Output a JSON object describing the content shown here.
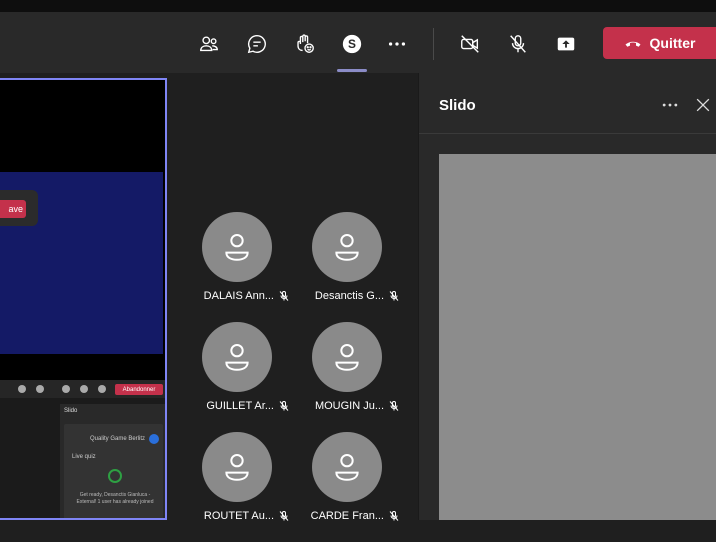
{
  "toolbar": {
    "icons": [
      "people-icon",
      "chat-icon",
      "raise-hand-icon",
      "slido-app-icon",
      "more-icon",
      "camera-off-icon",
      "mic-off-icon",
      "share-screen-icon"
    ],
    "slido_letter": "S",
    "leave_label": "Quitter",
    "leave_color": "#c4314b",
    "active_color": "#8b8cc7"
  },
  "shared_screen": {
    "prompt_button": "ave",
    "mini_leave": "Abandonner",
    "mini_panel_title": "Slido",
    "mini_event": "Quality Game Berlitz",
    "mini_tab": "Live quiz",
    "mini_message": "Get ready, Desanctis Gianluca - External! 1 user has already joined"
  },
  "participants": [
    {
      "name": "DALAIS Ann..."
    },
    {
      "name": "Desanctis G..."
    },
    {
      "name": "GUILLET Ar..."
    },
    {
      "name": "MOUGIN Ju..."
    },
    {
      "name": "ROUTET Au..."
    },
    {
      "name": "CARDE Fran..."
    }
  ],
  "side_panel": {
    "title": "Slido"
  }
}
